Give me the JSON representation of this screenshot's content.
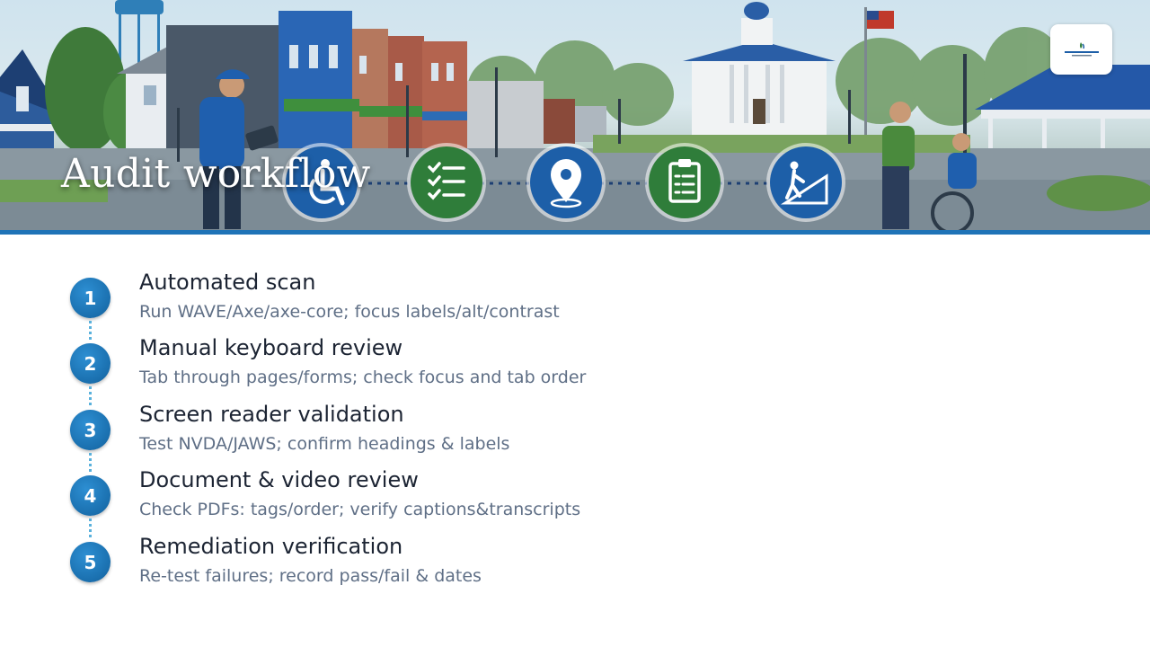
{
  "slide": {
    "title": "Audit workflow"
  },
  "banner": {
    "icons": [
      {
        "name": "wheelchair-icon",
        "color": "#1d5fa8"
      },
      {
        "name": "checklist-icon",
        "color": "#2f7d3a"
      },
      {
        "name": "location-pin-icon",
        "color": "#1d5fa8"
      },
      {
        "name": "clipboard-icon",
        "color": "#2f7d3a"
      },
      {
        "name": "ramp-icon",
        "color": "#1d5fa8"
      }
    ]
  },
  "steps": [
    {
      "number": "1",
      "title": "Automated scan",
      "description": "Run WAVE/Axe/axe-core; focus labels/alt/contrast"
    },
    {
      "number": "2",
      "title": "Manual keyboard review",
      "description": "Tab through pages/forms; check focus and tab order"
    },
    {
      "number": "3",
      "title": "Screen reader validation",
      "description": "Test NVDA/JAWS; confirm headings & labels"
    },
    {
      "number": "4",
      "title": "Document & video review",
      "description": "Check PDFs: tags/order; verify captions&transcripts"
    },
    {
      "number": "5",
      "title": "Remediation verification",
      "description": "Re-test failures; record pass/fail & dates"
    }
  ],
  "colors": {
    "accent": "#1f73b7",
    "badge": "#1a6fae",
    "title_text": "#1c2433",
    "description_text": "#5f6f86"
  }
}
